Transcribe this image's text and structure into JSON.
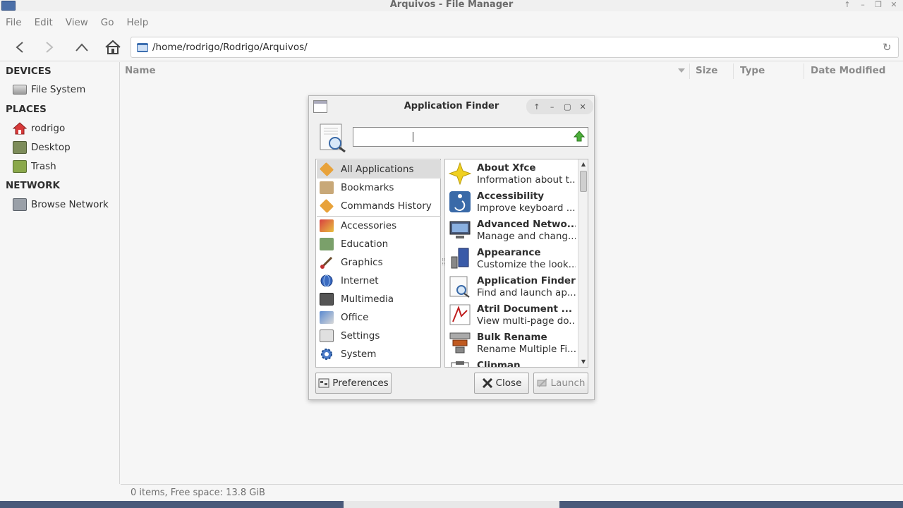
{
  "window": {
    "title": "Arquivos - File Manager"
  },
  "menu": [
    "File",
    "Edit",
    "View",
    "Go",
    "Help"
  ],
  "toolbar": {
    "path": "/home/rodrigo/Rodrigo/Arquivos/"
  },
  "sidebar": {
    "devices_header": "DEVICES",
    "devices": [
      "File System"
    ],
    "places_header": "PLACES",
    "places": [
      "rodrigo",
      "Desktop",
      "Trash"
    ],
    "network_header": "NETWORK",
    "network": [
      "Browse Network"
    ]
  },
  "columns": {
    "name": "Name",
    "size": "Size",
    "type": "Type",
    "date": "Date Modified"
  },
  "status": "0 items, Free space: 13.8 GiB",
  "dialog": {
    "title": "Application Finder",
    "search": {
      "value": ""
    },
    "categories_top": [
      "All Applications",
      "Bookmarks",
      "Commands History"
    ],
    "categories": [
      "Accessories",
      "Education",
      "Graphics",
      "Internet",
      "Multimedia",
      "Office",
      "Settings",
      "System"
    ],
    "apps": [
      {
        "name": "About Xfce",
        "desc": "Information about t..."
      },
      {
        "name": "Accessibility",
        "desc": "Improve keyboard ..."
      },
      {
        "name": "Advanced Netwo...",
        "desc": "Manage and chang..."
      },
      {
        "name": "Appearance",
        "desc": "Customize the look..."
      },
      {
        "name": "Application Finder",
        "desc": "Find and launch ap..."
      },
      {
        "name": "Atril Document ...",
        "desc": "View multi-page do..."
      },
      {
        "name": "Bulk Rename",
        "desc": "Rename Multiple Fi..."
      },
      {
        "name": "Clipman",
        "desc": ""
      }
    ],
    "buttons": {
      "preferences": "Preferences",
      "close": "Close",
      "launch": "Launch"
    }
  }
}
